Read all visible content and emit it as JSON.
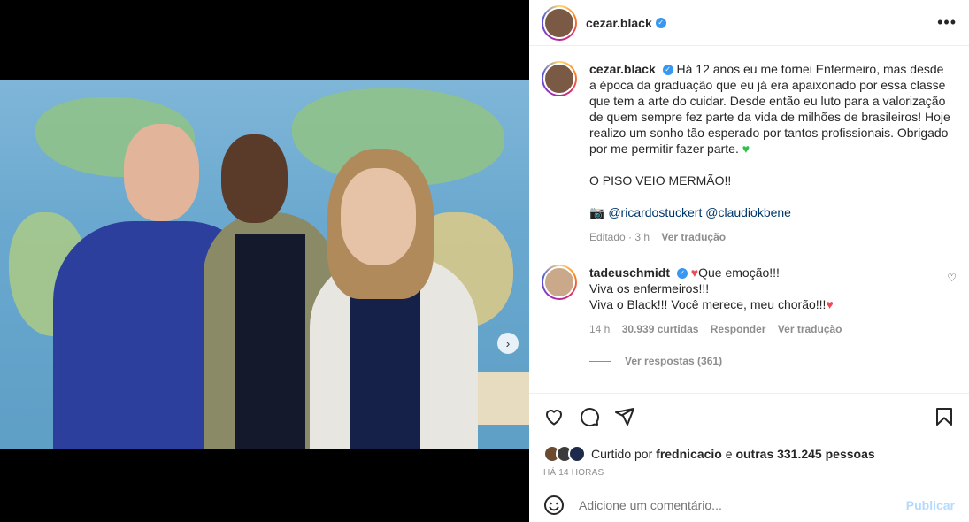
{
  "post": {
    "author": "cezar.black",
    "verified": true
  },
  "caption": {
    "username": "cezar.black",
    "lines": [
      "Há 12 anos eu me tornei Enfermeiro, mas desde a época da graduação que eu já era apaixonado por essa classe que tem a arte do cuidar. Desde então eu luto para a valorização de quem sempre fez parte da vida de milhões de brasileiros! Hoje realizo um sonho tão esperado por tantos profissionais. Obrigado por me permitir fazer parte.",
      "O PISO VEIO MERMÃO!!"
    ],
    "photo_prefix": "📷",
    "mention1": "@ricardostuckert",
    "mention2": "@claudiokbene",
    "edited": "Editado · 3 h",
    "see_translation": "Ver tradução"
  },
  "comment": {
    "username": "tadeuschmidt",
    "line1": "Que emoção!!!",
    "line2": "Viva os enfermeiros!!!",
    "line3": "Viva o Black!!! Você merece, meu chorão!!!",
    "time": "14 h",
    "likes": "30.939 curtidas",
    "reply": "Responder",
    "see_translation": "Ver tradução",
    "view_replies": "Ver respostas (361)"
  },
  "likes": {
    "prefix": "Curtido por",
    "user": "frednicacio",
    "middle": "e",
    "others": "outras 331.245 pessoas"
  },
  "timestamp": "HÁ 14 HORAS",
  "add_comment": {
    "placeholder": "Adicione um comentário...",
    "publish": "Publicar"
  },
  "carousel": {
    "total": 3,
    "active": 1
  },
  "icons": {
    "like": "heart-icon",
    "comment": "comment-icon",
    "share": "share-icon",
    "save": "bookmark-icon",
    "more": "more-icon",
    "emoji": "emoji-icon"
  },
  "colors": {
    "link": "#00376b",
    "verified": "#3897f0",
    "publish": "#b3dbff",
    "muted": "#8e8e8e"
  }
}
